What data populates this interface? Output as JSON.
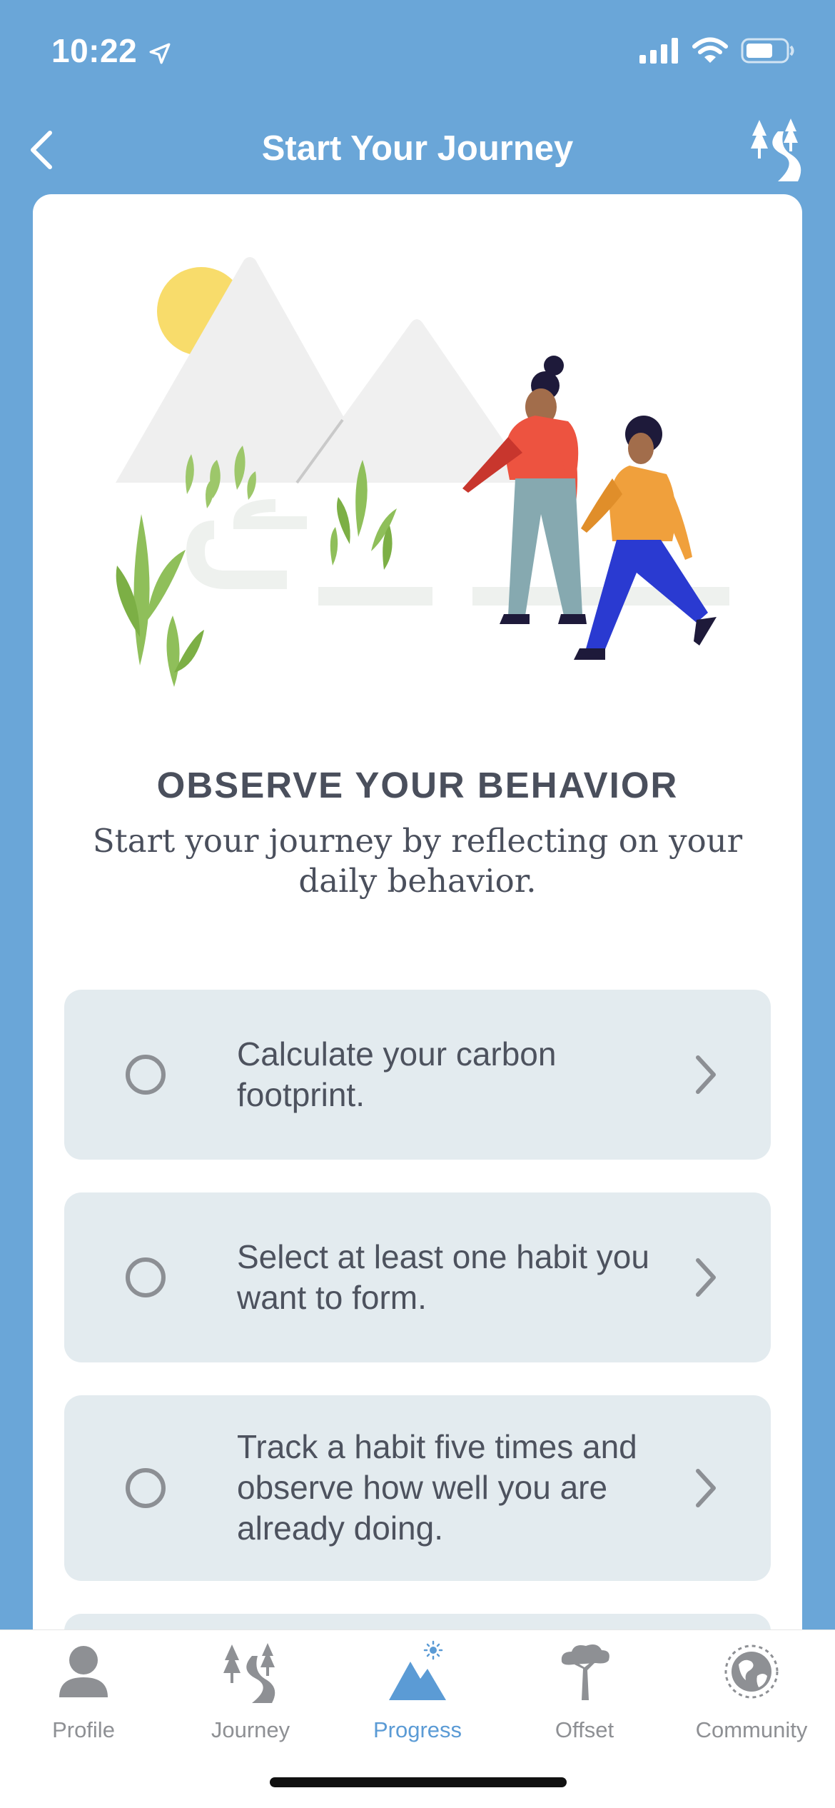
{
  "status_bar": {
    "time": "10:22"
  },
  "nav": {
    "title": "Start Your Journey"
  },
  "section": {
    "title": "OBSERVE YOUR BEHAVIOR",
    "subtitle": "Start your journey by reflecting on your daily behavior."
  },
  "tasks": [
    {
      "text": "Calculate your carbon footprint.",
      "completed": false
    },
    {
      "text": "Select at least one habit you want to form.",
      "completed": false
    },
    {
      "text": "Track a habit five times and observe how well you are already doing.",
      "completed": false
    }
  ],
  "tabs": [
    {
      "label": "Profile",
      "icon": "person-icon",
      "active": false
    },
    {
      "label": "Journey",
      "icon": "path-trees-icon",
      "active": false
    },
    {
      "label": "Progress",
      "icon": "mountain-sun-icon",
      "active": true
    },
    {
      "label": "Offset",
      "icon": "tree-icon",
      "active": false
    },
    {
      "label": "Community",
      "icon": "globe-icon",
      "active": false
    }
  ],
  "colors": {
    "background": "#6aa6d8",
    "card": "#ffffff",
    "task_bg": "#e3ebef",
    "text_dark": "#4a4f5c",
    "tab_active": "#5b9bd5",
    "tab_inactive": "#8e9094"
  }
}
